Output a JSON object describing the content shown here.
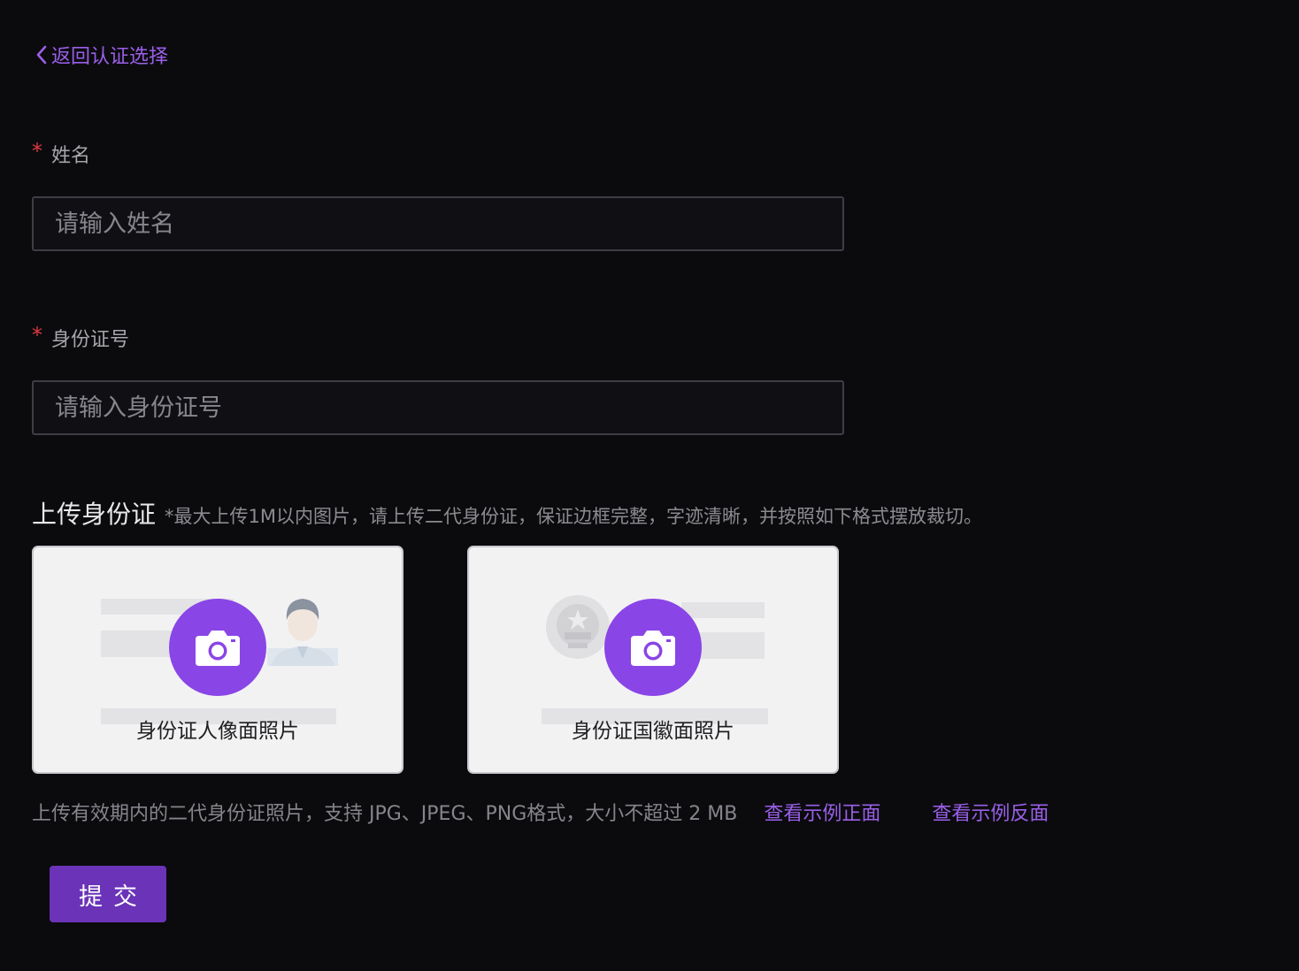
{
  "back_link": {
    "label": "返回认证选择",
    "icon": "chevron-left-icon"
  },
  "form": {
    "name": {
      "required_mark": "*",
      "label": "姓名",
      "placeholder": "请输入姓名",
      "value": ""
    },
    "id_number": {
      "required_mark": "*",
      "label": "身份证号",
      "placeholder": "请输入身份证号",
      "value": ""
    }
  },
  "upload": {
    "title": "上传身份证",
    "hint": "*最大上传1M以内图片，请上传二代身份证，保证边框完整，字迹清晰，并按照如下格式摆放裁切。",
    "front_card": {
      "caption": "身份证人像面照片",
      "icon": "camera-icon"
    },
    "back_card": {
      "caption": "身份证国徽面照片",
      "icon": "camera-icon"
    },
    "note": "上传有效期内的二代身份证照片，支持 JPG、JPEG、PNG格式，大小不超过 2 MB",
    "sample_front_link": "查看示例正面",
    "sample_back_link": "查看示例反面"
  },
  "submit_label": "提交",
  "colors": {
    "background": "#0b0b0e",
    "accent": "#9a5fe8",
    "camera_button": "#8a45e6",
    "submit_button": "#6a33b8",
    "required": "#e0393e"
  }
}
